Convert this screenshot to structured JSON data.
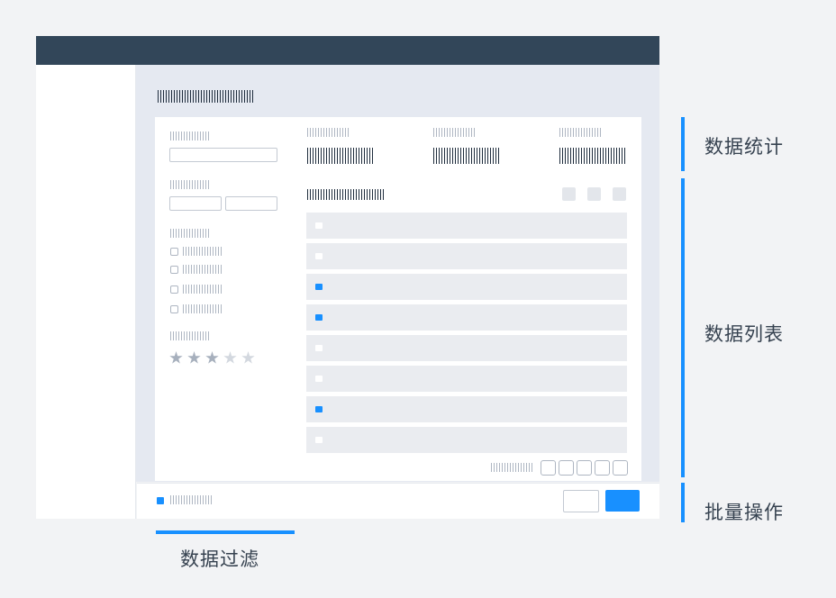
{
  "annotations": {
    "stats": "数据统计",
    "list": "数据列表",
    "batch": "批量操作",
    "filter": "数据过滤"
  },
  "filter_panel": {
    "rating": {
      "filled_stars": 3,
      "total_stars": 5
    },
    "checkbox_count": 4
  },
  "data_list": {
    "rows": [
      {
        "selected": false
      },
      {
        "selected": false
      },
      {
        "selected": true
      },
      {
        "selected": true
      },
      {
        "selected": false
      },
      {
        "selected": false
      },
      {
        "selected": true
      },
      {
        "selected": false
      }
    ],
    "page_buttons": 5
  },
  "colors": {
    "accent": "#1890ff",
    "header": "#324659",
    "content_bg": "#e5e9f1",
    "placeholder_text": "#aeb6c2",
    "strong_text": "#1f2d3d"
  }
}
